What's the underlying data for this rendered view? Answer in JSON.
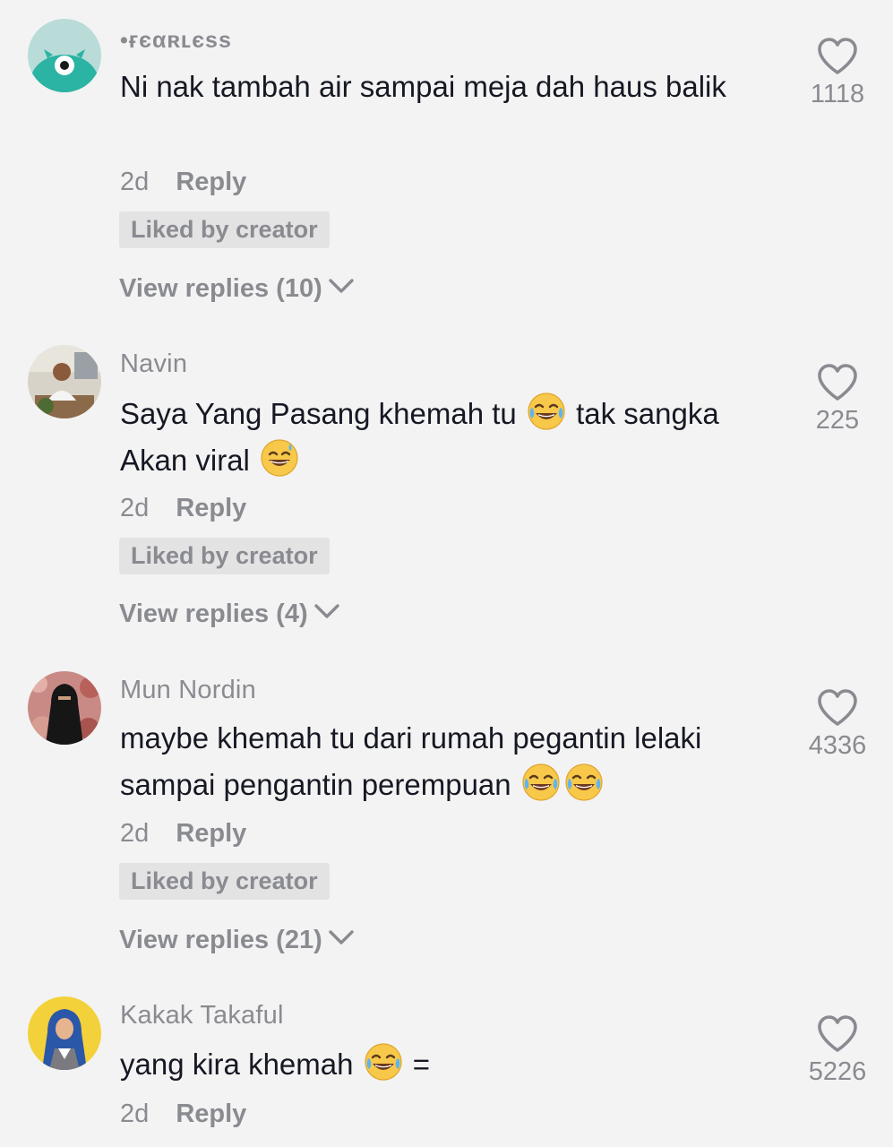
{
  "comments": [
    {
      "username": "•ғєαʀʟєss",
      "text_parts": [
        "Ni nak tambah air sampai meja dah haus balik"
      ],
      "time": "2d",
      "reply_label": "Reply",
      "liked_badge": "Liked by creator",
      "view_replies": "View replies (10)",
      "likes": "1118",
      "avatar_icon": "teal-monster-avatar"
    },
    {
      "username": "Navin",
      "text_parts": [
        "Saya Yang Pasang khemah tu ",
        " tak sangka Akan viral "
      ],
      "emojis": [
        "tears-of-joy-emoji",
        "grinning-sweat-emoji"
      ],
      "time": "2d",
      "reply_label": "Reply",
      "liked_badge": "Liked by creator",
      "view_replies": "View replies (4)",
      "likes": "225",
      "avatar_icon": "man-in-office-photo-avatar"
    },
    {
      "username": "Mun Nordin",
      "text_parts": [
        "maybe khemah tu dari rumah pegantin lelaki sampai pengantin perempuan "
      ],
      "emojis": [
        "tears-of-joy-emoji",
        "tears-of-joy-emoji"
      ],
      "time": "2d",
      "reply_label": "Reply",
      "liked_badge": "Liked by creator",
      "view_replies": "View replies (21)",
      "likes": "4336",
      "avatar_icon": "woman-in-niqab-photo-avatar"
    },
    {
      "username": "Kakak Takaful",
      "text_parts": [
        "yang kira khemah ",
        " ="
      ],
      "emojis": [
        "tears-of-joy-emoji"
      ],
      "time": "2d",
      "reply_label": "Reply",
      "likes": "5226",
      "avatar_icon": "woman-in-hijab-yellow-avatar"
    }
  ],
  "colors": {
    "background": "#f3f3f3",
    "text_primary": "#161823",
    "text_secondary": "#8a8b91",
    "badge_background": "#e3e3e4",
    "avatar_teal": "#2bb3a3",
    "avatar_yellow": "#f3d13a"
  }
}
